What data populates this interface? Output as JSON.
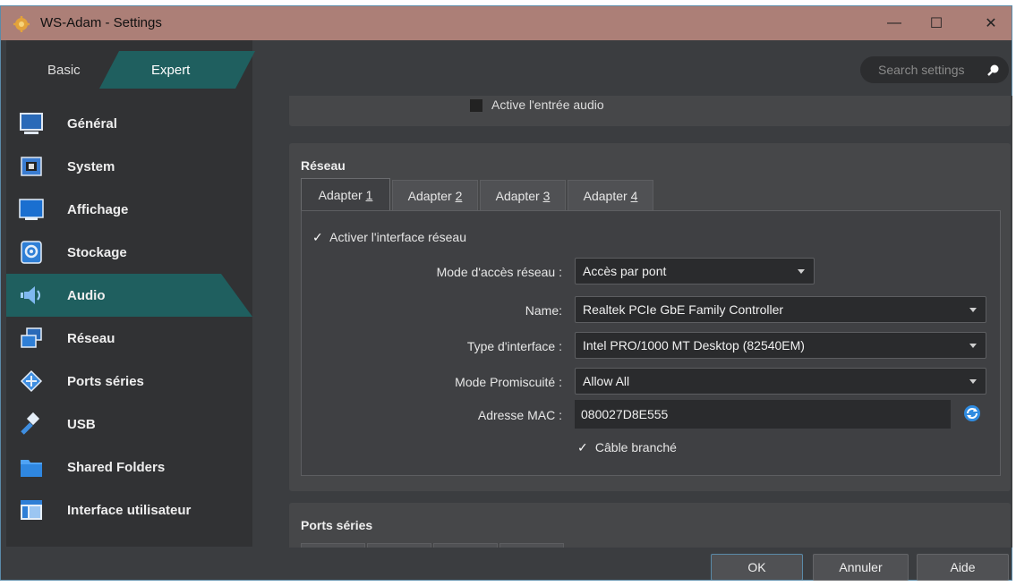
{
  "window": {
    "title": "WS-Adam - Settings",
    "minimize": "—",
    "maximize": "☐",
    "close": "✕"
  },
  "mode": {
    "basic": "Basic",
    "expert": "Expert"
  },
  "sidebar": {
    "items": [
      {
        "label": "Général",
        "icon": "monitor-icon"
      },
      {
        "label": "System",
        "icon": "chip-icon"
      },
      {
        "label": "Affichage",
        "icon": "display-icon"
      },
      {
        "label": "Stockage",
        "icon": "disk-icon"
      },
      {
        "label": "Audio",
        "icon": "speaker-icon",
        "active": true
      },
      {
        "label": "Réseau",
        "icon": "network-icon"
      },
      {
        "label": "Ports séries",
        "icon": "serial-port-icon"
      },
      {
        "label": "USB",
        "icon": "usb-icon"
      },
      {
        "label": "Shared Folders",
        "icon": "folder-icon"
      },
      {
        "label": "Interface utilisateur",
        "icon": "ui-window-icon"
      }
    ]
  },
  "search": {
    "placeholder": "Search settings"
  },
  "audio": {
    "input_label": "Active l'entrée audio"
  },
  "network": {
    "title": "Réseau",
    "tabs": [
      {
        "prefix": "Adapter ",
        "num": "1"
      },
      {
        "prefix": "Adapter ",
        "num": "2"
      },
      {
        "prefix": "Adapter ",
        "num": "3"
      },
      {
        "prefix": "Adapter ",
        "num": "4"
      }
    ],
    "enable_label": "Activer l'interface réseau",
    "access_mode_label": "Mode d'accès réseau :",
    "access_mode_value": "Accès par pont",
    "name_label": "Name:",
    "name_value": "Realtek PCIe GbE Family Controller",
    "type_label": "Type d'interface :",
    "type_value": "Intel PRO/1000 MT Desktop (82540EM)",
    "promisc_label": "Mode Promiscuité :",
    "promisc_value": "Allow All",
    "mac_label": "Adresse MAC :",
    "mac_value": "080027D8E555",
    "cable_label": "Câble branché",
    "check_mark": "✓"
  },
  "ports": {
    "title": "Ports séries"
  },
  "buttons": {
    "ok": "OK",
    "cancel": "Annuler",
    "help": "Aide"
  },
  "colors": {
    "accent": "#1f5f5f",
    "titlebar": "#ac7f77",
    "background": "#3b3d40"
  }
}
